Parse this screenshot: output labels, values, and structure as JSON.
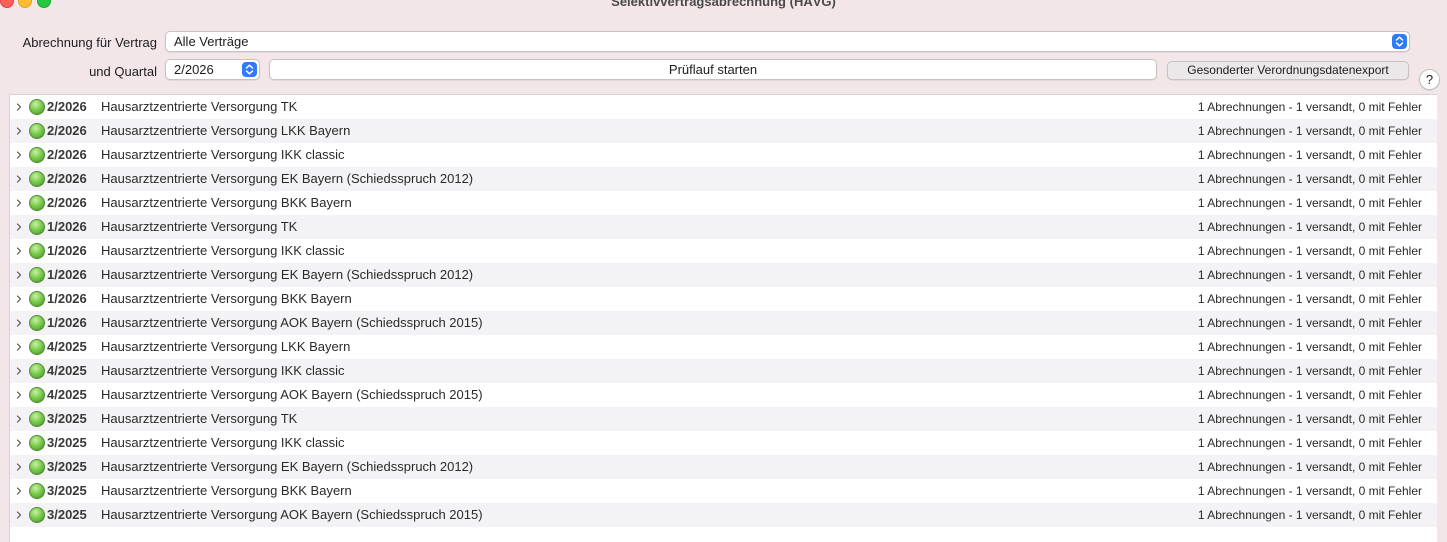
{
  "window": {
    "title": "Selektivvertragsabrechnung (HÄVG)"
  },
  "form": {
    "contract_label": "Abrechnung für Vertrag",
    "contract_value": "Alle Verträge",
    "quarter_label": "und Quartal",
    "quarter_value": "2/2026",
    "start_button": "Prüflauf starten",
    "export_button": "Gesonderter Verordnungsdatenexport",
    "help_label": "?"
  },
  "colors": {
    "accent": "#2f7bf5",
    "status_ok": "#6cc04a"
  },
  "icons": {
    "row_expand": "chevron-right-icon",
    "row_status": "green-status-dot-icon",
    "popup": "up-down-stepper-icon"
  },
  "rows": [
    {
      "quarter": "2/2026",
      "name": "Hausarztzentrierte Versorgung TK",
      "status": "1 Abrechnungen - 1 versandt, 0 mit Fehler"
    },
    {
      "quarter": "2/2026",
      "name": "Hausarztzentrierte Versorgung LKK Bayern",
      "status": "1 Abrechnungen - 1 versandt, 0 mit Fehler"
    },
    {
      "quarter": "2/2026",
      "name": "Hausarztzentrierte Versorgung IKK classic",
      "status": "1 Abrechnungen - 1 versandt, 0 mit Fehler"
    },
    {
      "quarter": "2/2026",
      "name": "Hausarztzentrierte Versorgung EK Bayern (Schiedsspruch 2012)",
      "status": "1 Abrechnungen - 1 versandt, 0 mit Fehler"
    },
    {
      "quarter": "2/2026",
      "name": "Hausarztzentrierte Versorgung BKK Bayern",
      "status": "1 Abrechnungen - 1 versandt, 0 mit Fehler"
    },
    {
      "quarter": "1/2026",
      "name": "Hausarztzentrierte Versorgung TK",
      "status": "1 Abrechnungen - 1 versandt, 0 mit Fehler"
    },
    {
      "quarter": "1/2026",
      "name": "Hausarztzentrierte Versorgung IKK classic",
      "status": "1 Abrechnungen - 1 versandt, 0 mit Fehler"
    },
    {
      "quarter": "1/2026",
      "name": "Hausarztzentrierte Versorgung EK Bayern (Schiedsspruch 2012)",
      "status": "1 Abrechnungen - 1 versandt, 0 mit Fehler"
    },
    {
      "quarter": "1/2026",
      "name": "Hausarztzentrierte Versorgung BKK Bayern",
      "status": "1 Abrechnungen - 1 versandt, 0 mit Fehler"
    },
    {
      "quarter": "1/2026",
      "name": "Hausarztzentrierte Versorgung AOK Bayern (Schiedsspruch 2015)",
      "status": "1 Abrechnungen - 1 versandt, 0 mit Fehler"
    },
    {
      "quarter": "4/2025",
      "name": "Hausarztzentrierte Versorgung LKK Bayern",
      "status": "1 Abrechnungen - 1 versandt, 0 mit Fehler"
    },
    {
      "quarter": "4/2025",
      "name": "Hausarztzentrierte Versorgung IKK classic",
      "status": "1 Abrechnungen - 1 versandt, 0 mit Fehler"
    },
    {
      "quarter": "4/2025",
      "name": "Hausarztzentrierte Versorgung AOK Bayern (Schiedsspruch 2015)",
      "status": "1 Abrechnungen - 1 versandt, 0 mit Fehler"
    },
    {
      "quarter": "3/2025",
      "name": "Hausarztzentrierte Versorgung TK",
      "status": "1 Abrechnungen - 1 versandt, 0 mit Fehler"
    },
    {
      "quarter": "3/2025",
      "name": "Hausarztzentrierte Versorgung IKK classic",
      "status": "1 Abrechnungen - 1 versandt, 0 mit Fehler"
    },
    {
      "quarter": "3/2025",
      "name": "Hausarztzentrierte Versorgung EK Bayern (Schiedsspruch 2012)",
      "status": "1 Abrechnungen - 1 versandt, 0 mit Fehler"
    },
    {
      "quarter": "3/2025",
      "name": "Hausarztzentrierte Versorgung BKK Bayern",
      "status": "1 Abrechnungen - 1 versandt, 0 mit Fehler"
    },
    {
      "quarter": "3/2025",
      "name": "Hausarztzentrierte Versorgung AOK Bayern (Schiedsspruch 2015)",
      "status": "1 Abrechnungen - 1 versandt, 0 mit Fehler"
    }
  ]
}
